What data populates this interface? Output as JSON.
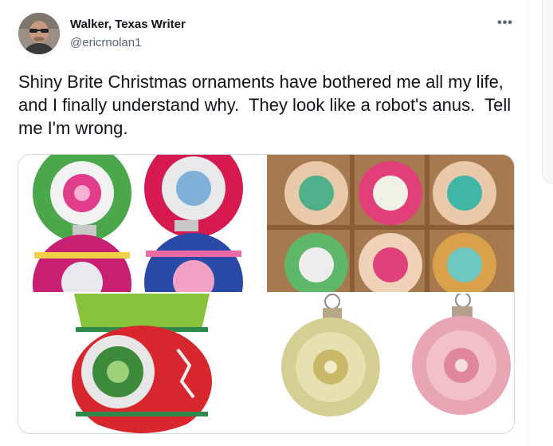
{
  "tweet": {
    "author_name": "Walker, Texas Writer",
    "author_handle": "@ericrnolan1",
    "more_icon": "more-horizontal-icon",
    "more_label": "•••",
    "text": "Shiny Brite Christmas ornaments have bothered me all my life, and I finally understand why.  They look like a robot's anus.  Tell me I'm wrong.",
    "media": {
      "count": 4
    }
  }
}
